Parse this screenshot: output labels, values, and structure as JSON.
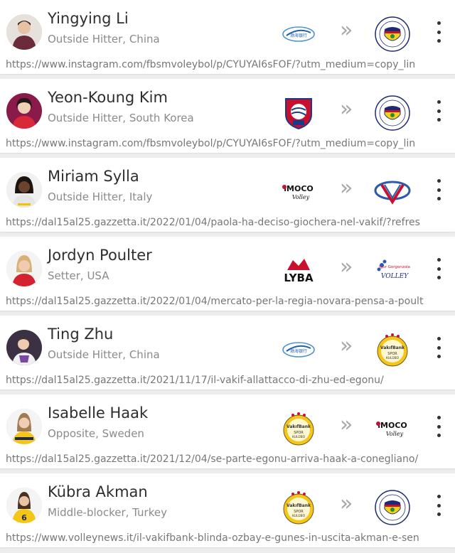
{
  "transfers": [
    {
      "name": "Yingying Li",
      "role": "Outside Hitter, China",
      "url": "https://www.instagram.com/fbsmvoleybol/p/CYUYAI6sFOF/?utm_medium=copy_lin",
      "from_logo": "tianjin-logo",
      "to_logo": "fenerbahce-logo"
    },
    {
      "name": "Yeon-Koung Kim",
      "role": "Outside Hitter, South Korea",
      "url": "https://www.instagram.com/fbsmvoleybol/p/CYUYAI6sFOF/?utm_medium=copy_lin",
      "from_logo": "heungkuk-logo",
      "to_logo": "fenerbahce-logo"
    },
    {
      "name": "Miriam Sylla",
      "role": "Outside Hitter, Italy",
      "url": "https://dal15al25.gazzetta.it/2022/01/04/paola-ha-deciso-giochera-nel-vakif/?refres",
      "from_logo": "imoco-volley-logo",
      "to_logo": "vakifbank-v-logo"
    },
    {
      "name": "Jordyn Poulter",
      "role": "Setter, USA",
      "url": "https://dal15al25.gazzetta.it/2022/01/04/mercato-per-la-regia-novara-pensa-a-poult",
      "from_logo": "lyba-logo",
      "to_logo": "novara-volley-logo"
    },
    {
      "name": "Ting Zhu",
      "role": "Outside Hitter, China",
      "url": "https://dal15al25.gazzetta.it/2021/11/17/il-vakif-allattacco-di-zhu-ed-egonu/",
      "from_logo": "tianjin-logo",
      "to_logo": "vakifbank-logo"
    },
    {
      "name": "Isabelle Haak",
      "role": "Opposite, Sweden",
      "url": "https://dal15al25.gazzetta.it/2021/12/04/se-parte-egonu-arriva-haak-a-conegliano/",
      "from_logo": "vakifbank-logo",
      "to_logo": "imoco-volley-logo"
    },
    {
      "name": "Kübra Akman",
      "role": "Middle-blocker, Turkey",
      "url": "https://www.volleynews.it/il-vakifbank-blinda-ozbay-e-gunes-in-uscita-akman-e-sen",
      "from_logo": "vakifbank-logo",
      "to_logo": "fenerbahce-logo"
    }
  ],
  "labels": {
    "arrow": "»",
    "tianjin": "渤海银行",
    "imoco": "iMOCO",
    "volley": "Volley",
    "lyba": "LYBA",
    "vakif": "VakıfBank",
    "spor": "SPOR",
    "kulubu": "KULÜBÜ",
    "igor": "Igor Gorgonzola",
    "novara": "VOLLEY"
  },
  "colors": {
    "name": "#2e2e2e",
    "role": "#8a8a8a",
    "url": "#777777",
    "fener_navy": "#1e2a6e",
    "fener_yellow": "#f2d21b",
    "vakif_yellow": "#f5c518",
    "red": "#c8102e"
  }
}
